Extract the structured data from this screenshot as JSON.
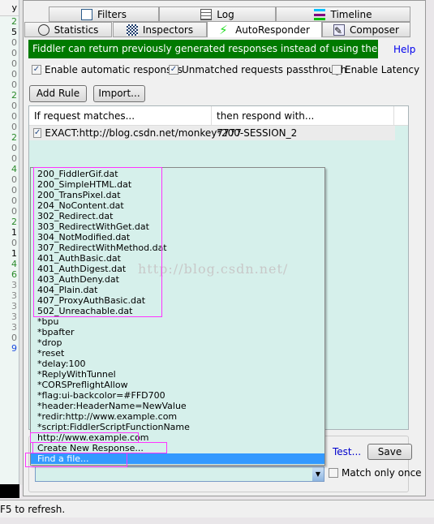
{
  "left_column": {
    "header": "y",
    "values": [
      "2",
      "5",
      "0",
      "0",
      "0",
      "0",
      "0",
      "2",
      "0",
      "0",
      "0",
      "2",
      "0",
      "0",
      "4",
      "0",
      "0",
      "0",
      "0",
      "2",
      "1",
      "0",
      "1",
      "4",
      "6",
      "3",
      "3",
      "3",
      "3",
      "3",
      "0",
      "9"
    ]
  },
  "tabs_row1": [
    {
      "label": "Filters",
      "icon": "filters-icon"
    },
    {
      "label": "Log",
      "icon": "log-icon"
    },
    {
      "label": "Timeline",
      "icon": "timeline-icon"
    }
  ],
  "tabs_row2": [
    {
      "label": "Statistics",
      "icon": "stopwatch-icon"
    },
    {
      "label": "Inspectors",
      "icon": "inspectors-icon"
    },
    {
      "label": "AutoResponder",
      "icon": "lightning-icon",
      "active": true
    },
    {
      "label": "Composer",
      "icon": "composer-icon"
    }
  ],
  "banner": {
    "text": "Fiddler can return previously generated responses instead of using the network.",
    "color": "#007a00"
  },
  "help_link": "Help",
  "options": [
    {
      "label": "Enable automatic responses",
      "checked": true
    },
    {
      "label": "Unmatched requests passthrough",
      "checked": true
    },
    {
      "label": "Enable Latency",
      "checked": false
    }
  ],
  "buttons": {
    "add_rule": "Add Rule",
    "import": "Import...",
    "test": "Test...",
    "save": "Save"
  },
  "table": {
    "columns": [
      "If request matches...",
      "then respond with..."
    ],
    "rows": [
      {
        "checked": true,
        "match": "EXACT:http://blog.csdn.net/monkey7777",
        "response": "*200-SESSION_2"
      }
    ]
  },
  "dropdown_options": [
    "200_FiddlerGif.dat",
    "200_SimpleHTML.dat",
    "200_TransPixel.dat",
    "204_NoContent.dat",
    "302_Redirect.dat",
    "303_RedirectWithGet.dat",
    "304_NotModified.dat",
    "307_RedirectWithMethod.dat",
    "401_AuthBasic.dat",
    "401_AuthDigest.dat",
    "403_AuthDeny.dat",
    "404_Plain.dat",
    "407_ProxyAuthBasic.dat",
    "502_Unreachable.dat",
    "*bpu",
    "*bpafter",
    "*drop",
    "*reset",
    "*delay:100",
    "*ReplyWithTunnel",
    "*CORSPreflightAllow",
    "*flag:ui-backcolor=#FFD700",
    "*header:HeaderName=NewValue",
    "*redir:http://www.example.com",
    "*script:FiddlerScriptFunctionName",
    "http://www.example.com",
    "Create New Response...",
    "Find a file..."
  ],
  "selected_option": "Find a file...",
  "watermark": "http://blog.csdn.net/",
  "response_combo_value": "",
  "match_only_once": {
    "label": "Match only once",
    "checked": false
  },
  "status_text": "F5 to refresh.",
  "accent_color": "#3399ff",
  "highlight_color": "#ff33ff"
}
